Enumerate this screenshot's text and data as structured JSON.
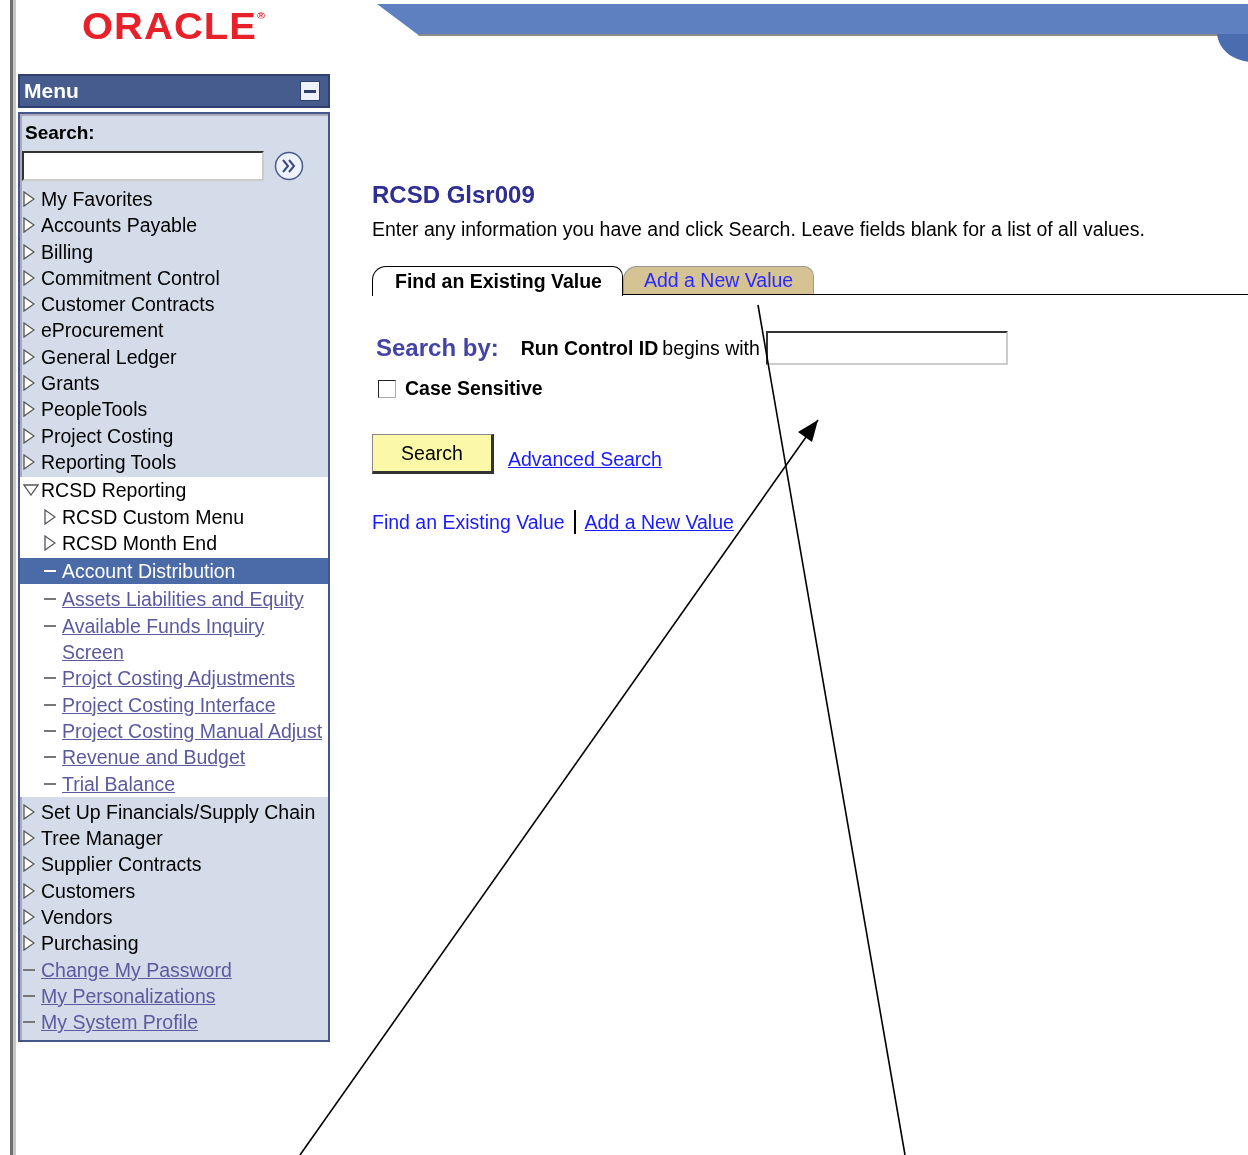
{
  "logo": {
    "text": "ORACLE$^{®}$"
  },
  "menu": {
    "title": "Menu",
    "search_label": "Search:",
    "items": [
      {
        "kind": "folder",
        "label": "My Favorites",
        "expanded": false,
        "selected": false
      },
      {
        "kind": "folder",
        "label": "Accounts Payable",
        "expanded": false,
        "selected": false
      },
      {
        "kind": "folder",
        "label": "Billing",
        "expanded": false,
        "selected": false
      },
      {
        "kind": "folder",
        "label": "Commitment Control",
        "expanded": false,
        "selected": false
      },
      {
        "kind": "folder",
        "label": "Customer Contracts",
        "expanded": false,
        "selected": false
      },
      {
        "kind": "folder",
        "label": "eProcurement",
        "expanded": false,
        "selected": false
      },
      {
        "kind": "folder",
        "label": "General Ledger",
        "expanded": false,
        "selected": false
      },
      {
        "kind": "folder",
        "label": "Grants",
        "expanded": false,
        "selected": false
      },
      {
        "kind": "folder",
        "label": "PeopleTools",
        "expanded": false,
        "selected": false
      },
      {
        "kind": "folder",
        "label": "Project Costing",
        "expanded": false,
        "selected": false
      },
      {
        "kind": "folder",
        "label": "Reporting Tools",
        "expanded": false,
        "selected": false
      },
      {
        "kind": "folder",
        "label": "RCSD Reporting",
        "expanded": true,
        "selected": false,
        "children": [
          {
            "kind": "folder",
            "label": "RCSD Custom Menu",
            "expanded": false,
            "selected": false
          },
          {
            "kind": "folder",
            "label": "RCSD Month End",
            "expanded": false,
            "selected": false
          },
          {
            "kind": "link",
            "label": "Account Distribution",
            "selected": true
          },
          {
            "kind": "link",
            "label": "Assets Liabilities and Equity",
            "selected": false
          },
          {
            "kind": "link",
            "label": "Available Funds Inquiry Screen",
            "selected": false
          },
          {
            "kind": "link",
            "label": "Projct Costing Adjustments",
            "selected": false
          },
          {
            "kind": "link",
            "label": "Project Costing Interface",
            "selected": false
          },
          {
            "kind": "link",
            "label": "Project Costing Manual Adjust",
            "selected": false
          },
          {
            "kind": "link",
            "label": "Revenue and Budget",
            "selected": false
          },
          {
            "kind": "link",
            "label": "Trial Balance",
            "selected": false
          }
        ]
      },
      {
        "kind": "folder",
        "label": "Set Up Financials/Supply Chain",
        "expanded": false,
        "selected": false
      },
      {
        "kind": "folder",
        "label": "Tree Manager",
        "expanded": false,
        "selected": false
      },
      {
        "kind": "folder",
        "label": "Supplier Contracts",
        "expanded": false,
        "selected": false
      },
      {
        "kind": "folder",
        "label": "Customers",
        "expanded": false,
        "selected": false
      },
      {
        "kind": "folder",
        "label": "Vendors",
        "expanded": false,
        "selected": false
      },
      {
        "kind": "folder",
        "label": "Purchasing",
        "expanded": false,
        "selected": false
      },
      {
        "kind": "link",
        "label": "Change My Password",
        "selected": false
      },
      {
        "kind": "link",
        "label": "My Personalizations",
        "selected": false
      },
      {
        "kind": "link",
        "label": "My System Profile",
        "selected": false
      }
    ]
  },
  "page": {
    "title": "RCSD Glsr009",
    "instructions": "Enter any information you have and click Search. Leave fields blank for a list of all values.",
    "tabs": [
      {
        "label": "Find an Existing Value",
        "selected": true
      },
      {
        "label": "Add a New Value",
        "selected": false
      }
    ],
    "search_by": {
      "heading": "Search by:",
      "field_label": "Run Control ID",
      "operator": "begins with"
    },
    "case_sensitive": {
      "label": "Case Sensitive",
      "checked": false
    },
    "search_button": "Search",
    "advanced_search": "Advanced Search",
    "bottom_links": [
      {
        "label": "Find an Existing Value",
        "selected": true
      },
      {
        "label": "Add a New Value",
        "selected": false
      }
    ]
  }
}
